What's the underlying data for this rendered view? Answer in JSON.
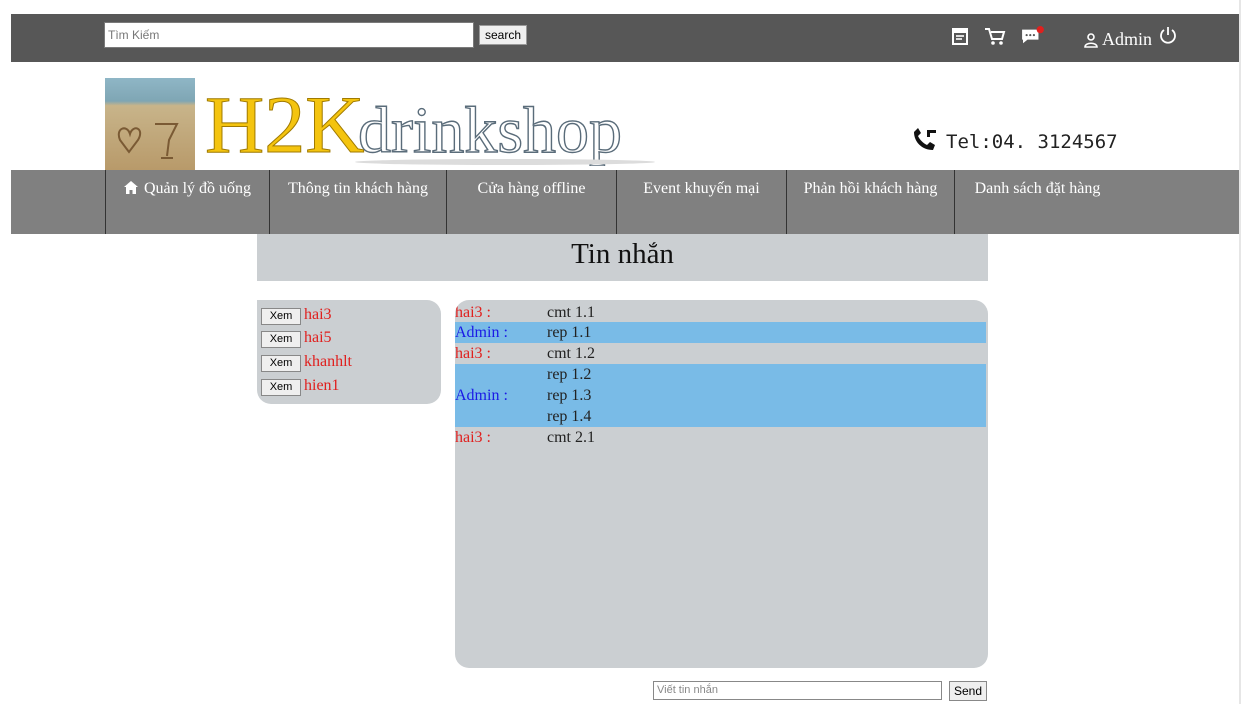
{
  "topbar": {
    "search_placeholder": "Tìm Kiếm",
    "search_button": "search",
    "icons": [
      "calendar-icon",
      "cart-icon",
      "message-icon",
      "user-icon",
      "power-icon"
    ],
    "admin_label": "Admin"
  },
  "header": {
    "logo_text": "H2Kdrinkshop",
    "tel": "Tel:04. 3124567"
  },
  "nav": {
    "items": [
      {
        "label": "Quản lý đồ uống",
        "icon": "home-icon"
      },
      {
        "label": "Thông tin khách hàng"
      },
      {
        "label": "Cửa hàng offline"
      },
      {
        "label": "Event khuyến mại"
      },
      {
        "label": "Phản hồi khách hàng"
      },
      {
        "label": "Danh sách đặt hàng"
      }
    ]
  },
  "page": {
    "title": "Tin nhắn"
  },
  "users": {
    "view_label": "Xem",
    "list": [
      "hai3",
      "hai5",
      "khanhlt",
      "hien1"
    ]
  },
  "chat": {
    "messages": [
      {
        "sender": "hai3 :",
        "lines": [
          "cmt 1.1"
        ],
        "role": "user"
      },
      {
        "sender": "Admin :",
        "lines": [
          "rep 1.1"
        ],
        "role": "admin"
      },
      {
        "sender": "hai3 :",
        "lines": [
          "cmt 1.2"
        ],
        "role": "user"
      },
      {
        "sender": "Admin :",
        "lines": [
          "rep 1.2",
          "rep 1.3",
          "rep 1.4"
        ],
        "role": "admin"
      },
      {
        "sender": "hai3 :",
        "lines": [
          "cmt 2.1"
        ],
        "role": "user"
      }
    ]
  },
  "compose": {
    "placeholder": "Viết tin nhắn",
    "send_label": "Send"
  },
  "colors": {
    "topbar": "#575757",
    "nav": "#808080",
    "panel": "#cbcfd2",
    "admin_highlight": "#79bbe7",
    "user_name": "#e0201e",
    "admin_name": "#1a1ae6",
    "logo_yellow": "#f4c40f"
  }
}
